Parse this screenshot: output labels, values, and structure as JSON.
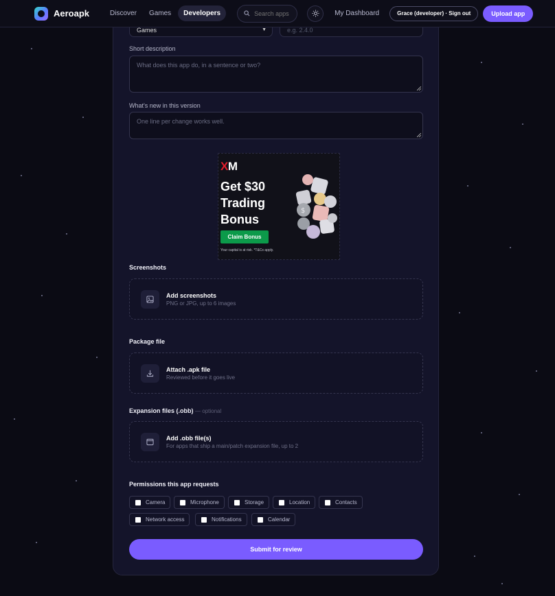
{
  "nav": {
    "brand": "Aeroapk",
    "links": [
      "Discover",
      "Games",
      "Developers"
    ],
    "search_placeholder": "Search apps",
    "dashboard": "My Dashboard",
    "user": "Grace (developer) · Sign out",
    "upload": "Upload app"
  },
  "form": {
    "category_value": "Games",
    "version_placeholder": "e.g. 2.4.0",
    "short_desc_label": "Short description",
    "short_desc_placeholder": "What does this app do, in a sentence or two?",
    "whats_new_label": "What's new in this version",
    "whats_new_placeholder": "One line per change works well.",
    "screenshots_label": "Screenshots",
    "screenshots_title": "Add screenshots",
    "screenshots_sub": "PNG or JPG, up to 6 images",
    "package_label": "Package file",
    "package_title": "Attach .apk file",
    "package_sub": "Reviewed before it goes live",
    "obb_label": "Expansion files (.obb)",
    "obb_optional": "— optional",
    "obb_title": "Add .obb file(s)",
    "obb_sub": "For apps that ship a main/patch expansion file, up to 2",
    "permissions_label": "Permissions this app requests",
    "permissions": [
      "Camera",
      "Microphone",
      "Storage",
      "Location",
      "Contacts",
      "Network access",
      "Notifications",
      "Calendar"
    ],
    "submit": "Submit for review"
  },
  "ad": {
    "logo_x": "X",
    "logo_m": "M",
    "headline": "Get $30 Trading Bonus",
    "button": "Claim Bonus",
    "disclaimer": "Your capital is at risk. *T&Cs apply."
  },
  "icons": [
    "search-icon",
    "sun-icon",
    "chevron-down-icon",
    "image-icon",
    "download-icon",
    "window-icon"
  ],
  "colors": {
    "accent": "#7a5cff",
    "background": "#0b0b14",
    "card": "#14142a",
    "ad_green": "#0c9a4a",
    "ad_red": "#e11d2b"
  }
}
